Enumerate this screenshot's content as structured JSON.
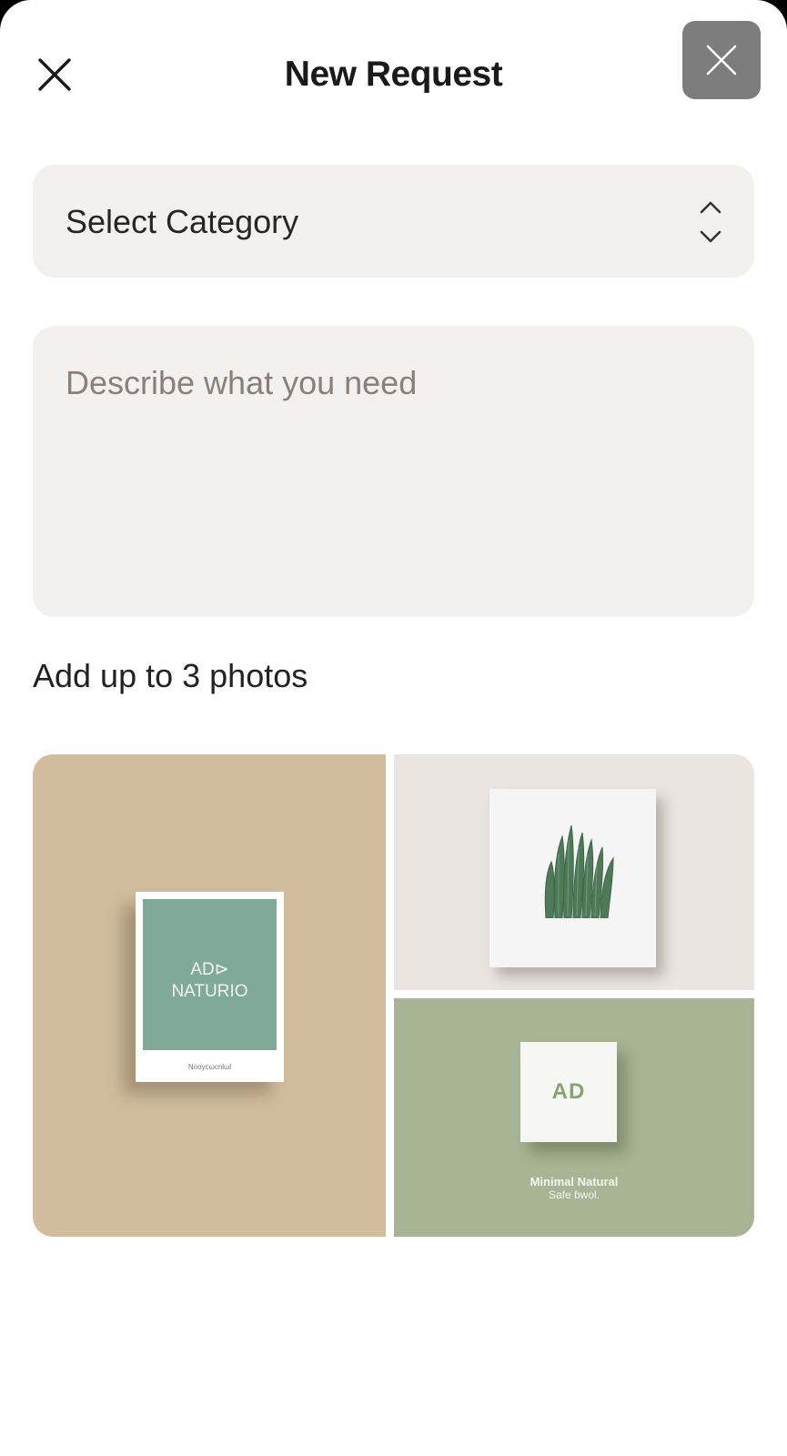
{
  "header": {
    "title": "New Request"
  },
  "form": {
    "category_label": "Select Category",
    "description_placeholder": "Describe what you need",
    "photos_label": "Add up to 3 photos"
  },
  "photos": [
    {
      "line1": "AD⊳",
      "line2": "NATURIO",
      "footer": "Noоyсωсnlωl"
    },
    {
      "subject": "cactus plant on white card"
    },
    {
      "mark": "AD",
      "caption_line1": "Minimal Natural",
      "caption_line2": "Safe ɓwol."
    }
  ],
  "colors": {
    "close_button_bg": "#7d7d7d",
    "field_bg": "#f2f1f0",
    "photo1_bg": "#d1bd9e",
    "photo2_bg": "#ebe5e1",
    "photo3_bg": "#a8b493"
  },
  "icons": {
    "close_left": "close-icon",
    "close_right": "close-icon",
    "select_arrows": "chevron-up-down-icon"
  }
}
